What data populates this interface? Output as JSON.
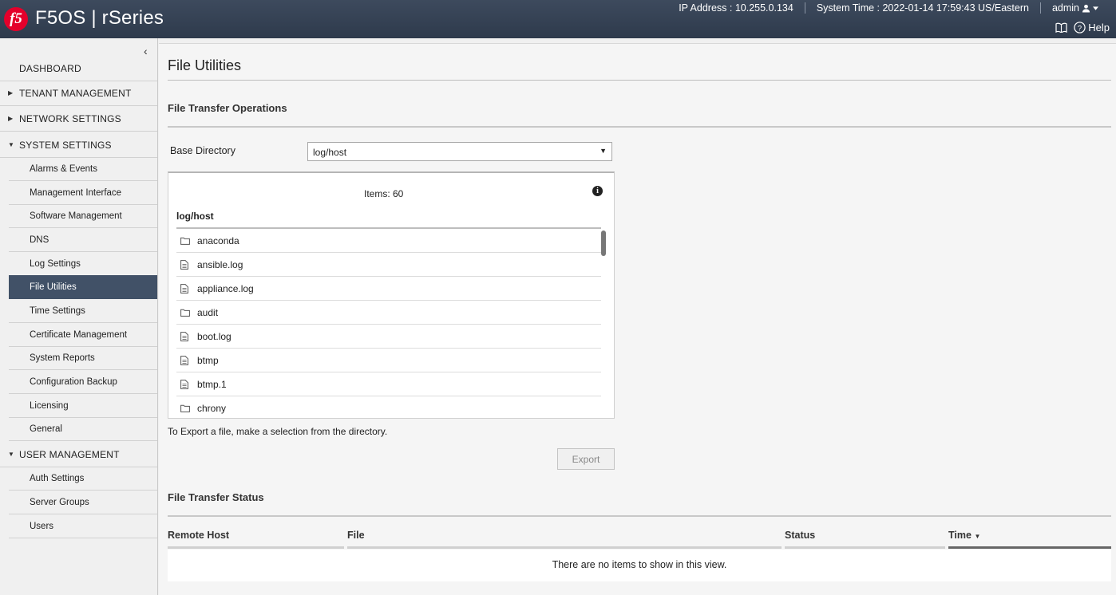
{
  "header": {
    "logo_text": "f5",
    "brand": "F5OS | rSeries",
    "ip_address": "IP Address : 10.255.0.134",
    "system_time": "System Time : 2022-01-14 17:59:43 US/Eastern",
    "user": "admin",
    "help_label": "Help"
  },
  "sidebar": {
    "dashboard": "DASHBOARD",
    "tenant_management": "TENANT MANAGEMENT",
    "network_settings": "NETWORK SETTINGS",
    "system_settings": "SYSTEM SETTINGS",
    "system_items": [
      "Alarms & Events",
      "Management Interface",
      "Software Management",
      "DNS",
      "Log Settings",
      "File Utilities",
      "Time Settings",
      "Certificate Management",
      "System Reports",
      "Configuration Backup",
      "Licensing",
      "General"
    ],
    "user_management": "USER MANAGEMENT",
    "user_items": [
      "Auth Settings",
      "Server Groups",
      "Users"
    ],
    "active_item": "File Utilities"
  },
  "main": {
    "page_title": "File Utilities",
    "transfer_ops_title": "File Transfer Operations",
    "base_dir_label": "Base Directory",
    "base_dir_value": "log/host",
    "items_count": "Items: 60",
    "dir_path": "log/host",
    "files": [
      {
        "name": "anaconda",
        "type": "folder"
      },
      {
        "name": "ansible.log",
        "type": "file"
      },
      {
        "name": "appliance.log",
        "type": "file"
      },
      {
        "name": "audit",
        "type": "folder"
      },
      {
        "name": "boot.log",
        "type": "file"
      },
      {
        "name": "btmp",
        "type": "file"
      },
      {
        "name": "btmp.1",
        "type": "file"
      },
      {
        "name": "chrony",
        "type": "folder"
      }
    ],
    "export_hint": "To Export a file, make a selection from the directory.",
    "export_label": "Export",
    "status_title": "File Transfer Status",
    "columns": [
      "Remote Host",
      "File",
      "Status",
      "Time"
    ],
    "empty_message": "There are no items to show in this view."
  }
}
